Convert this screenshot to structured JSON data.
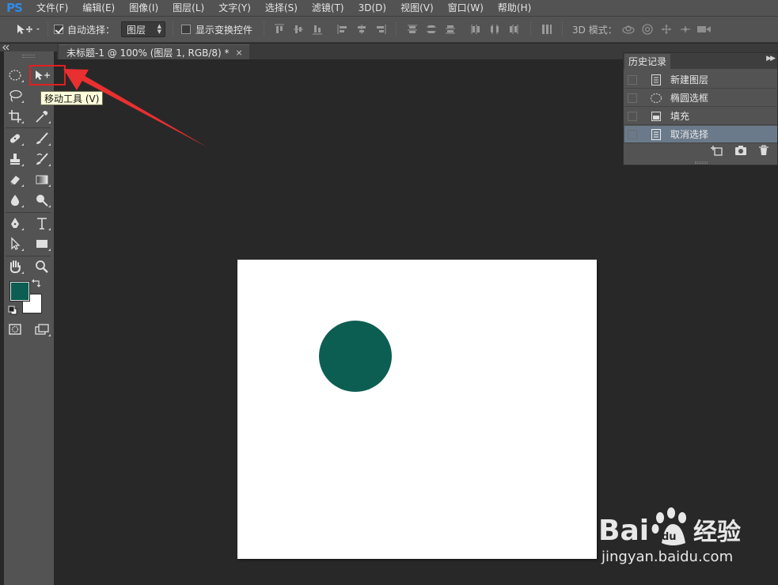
{
  "app": {
    "logo": "PS",
    "accent_color": "#2e8be8"
  },
  "menu": {
    "items": [
      "文件(F)",
      "编辑(E)",
      "图像(I)",
      "图层(L)",
      "文字(Y)",
      "选择(S)",
      "滤镜(T)",
      "3D(D)",
      "视图(V)",
      "窗口(W)",
      "帮助(H)"
    ]
  },
  "options_bar": {
    "tool_icon": "move-tool-icon",
    "auto_select_label": "自动选择：",
    "auto_select_checked": true,
    "auto_select_target": "图层",
    "show_transform_label": "显示变换控件",
    "show_transform_checked": false,
    "mode_3d_label": "3D 模式："
  },
  "document": {
    "tab_title": "未标题-1 @ 100% (图层 1, RGB/8) *",
    "tab_close": "×",
    "canvas_background": "#ffffff",
    "shape_color": "#0d5e52",
    "shape": "circle"
  },
  "toolbar": {
    "collapse_icon": "double-chevron-left-icon",
    "foreground_color": "#0d5e52",
    "background_color": "#ffffff",
    "tooltip": "移动工具 (V)"
  },
  "history_panel": {
    "tab_label": "历史记录",
    "menu_icon": "panel-menu-icon",
    "items": [
      {
        "label": "新建图层",
        "icon": "document-icon",
        "selected": false
      },
      {
        "label": "椭圆选框",
        "icon": "ellipse-marquee-icon",
        "selected": false
      },
      {
        "label": "填充",
        "icon": "fill-icon",
        "selected": false
      },
      {
        "label": "取消选择",
        "icon": "document-icon",
        "selected": true
      }
    ],
    "footer_icons": [
      "new-document-from-state-icon",
      "snapshot-camera-icon",
      "trash-icon"
    ]
  },
  "annotation": {
    "highlight_color": "#e02020"
  },
  "watermark": {
    "brand": "Bai经验",
    "url": "jingyan.baidu.com"
  }
}
